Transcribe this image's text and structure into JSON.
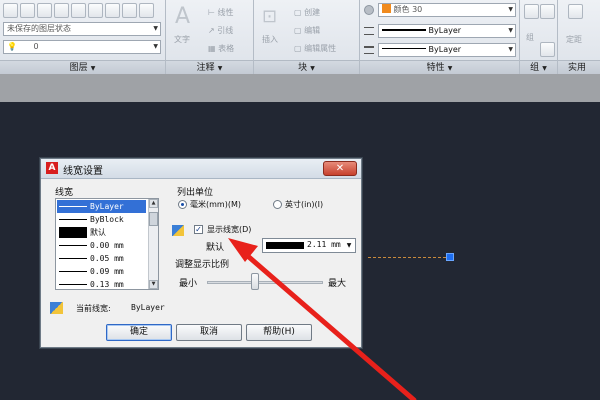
{
  "ribbon": {
    "layer_combo_value": "未保存的图层状态",
    "layer_dropdown_value": "0",
    "text_label": "文字",
    "dim_label": "标注",
    "linear_label": "线性",
    "leader_label": "引线",
    "table_label": "表格",
    "insert_label": "插入",
    "create_label": "创建",
    "edit_label": "编辑",
    "edit_attr_label": "编辑属性",
    "color_combo_value": "颜色 30",
    "linetype_value": "ByLayer",
    "lineweight_value": "ByLayer",
    "group_btn_label": "组",
    "util_label": "定距",
    "panel_titles": [
      "图层",
      "注释",
      "块",
      "特性",
      "组",
      "实用"
    ]
  },
  "dialog": {
    "title": "线宽设置",
    "lineweights_header": "线宽",
    "lineweights": [
      {
        "label": "ByLayer",
        "selected": true
      },
      {
        "label": "ByBlock",
        "selected": false
      },
      {
        "label": "默认",
        "selected": false
      },
      {
        "label": "0.00 mm",
        "selected": false
      },
      {
        "label": "0.05 mm",
        "selected": false
      },
      {
        "label": "0.09 mm",
        "selected": false
      },
      {
        "label": "0.13 mm",
        "selected": false
      }
    ],
    "units_header": "列出单位",
    "unit_mm": "毫米(mm)(M)",
    "unit_in": "英寸(in)(I)",
    "display_lw_label": "显示线宽(D)",
    "default_label": "默认",
    "default_value": "2.11 mm",
    "scale_header": "调整显示比例",
    "scale_min": "最小",
    "scale_max": "最大",
    "current_lw_label": "当前线宽:",
    "current_lw_value": "ByLayer",
    "ok_label": "确定",
    "cancel_label": "取消",
    "help_label": "帮助(H)"
  },
  "colors": {
    "canvas_bg": "#222733",
    "annotation_arrow": "#e8211b",
    "selection": "#3370d6",
    "grip": "#1e6ef0"
  }
}
